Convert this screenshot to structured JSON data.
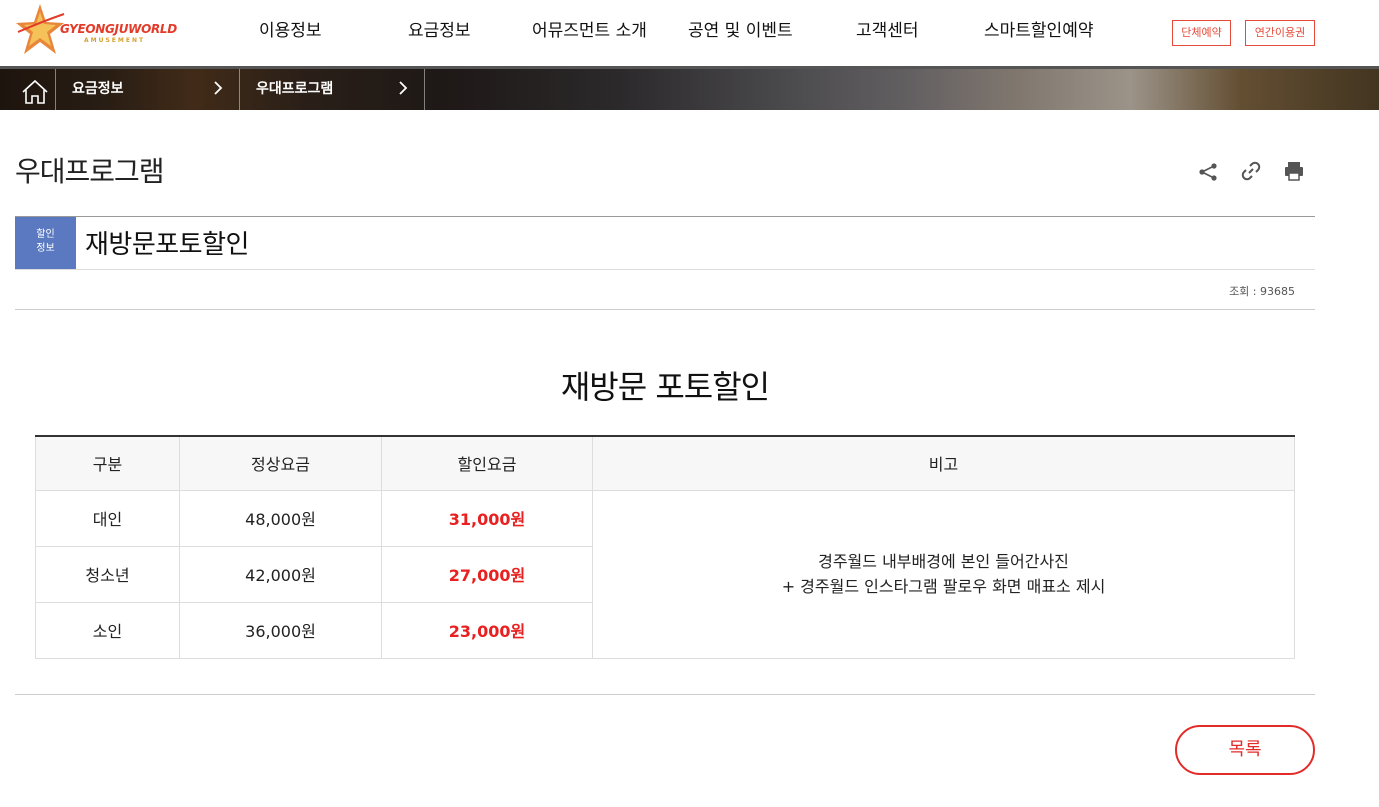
{
  "header": {
    "logo": {
      "text": "GYEONGJUWORLD",
      "sub": "AMUSEMENT"
    },
    "nav": [
      "이용정보",
      "요금정보",
      "어뮤즈먼트 소개",
      "공연 및 이벤트",
      "고객센터",
      "스마트할인예약"
    ],
    "buttons": {
      "group": "단체예약",
      "annual": "연간이용권"
    }
  },
  "breadcrumb": {
    "level1": "요금정보",
    "level2": "우대프로그램"
  },
  "page_title": "우대프로그램",
  "article": {
    "badge": "할인정보",
    "badge_line1": "할인",
    "badge_line2": "정보",
    "title": "재방문포토할인",
    "views_label": "조회",
    "views": "93685",
    "views_text": "조회 : 93685"
  },
  "content": {
    "title": "재방문 포토할인",
    "table": {
      "headers": [
        "구분",
        "정상요금",
        "할인요금",
        "비고"
      ],
      "rows": [
        {
          "type": "대인",
          "regular": "48,000원",
          "discount": "31,000원"
        },
        {
          "type": "청소년",
          "regular": "42,000원",
          "discount": "27,000원"
        },
        {
          "type": "소인",
          "regular": "36,000원",
          "discount": "23,000원"
        }
      ],
      "note_line1": "경주월드 내부배경에 본인 들어간사진",
      "note_line2": "+ 경주월드 인스타그램 팔로우 화면 매표소 제시"
    }
  },
  "list_button": "목록",
  "colors": {
    "accent": "#e32c2a",
    "badge": "#5b79c0",
    "sale": "#e8201f"
  },
  "icons": [
    "home-icon",
    "chevron-right-icon",
    "share-icon",
    "link-icon",
    "print-icon"
  ]
}
